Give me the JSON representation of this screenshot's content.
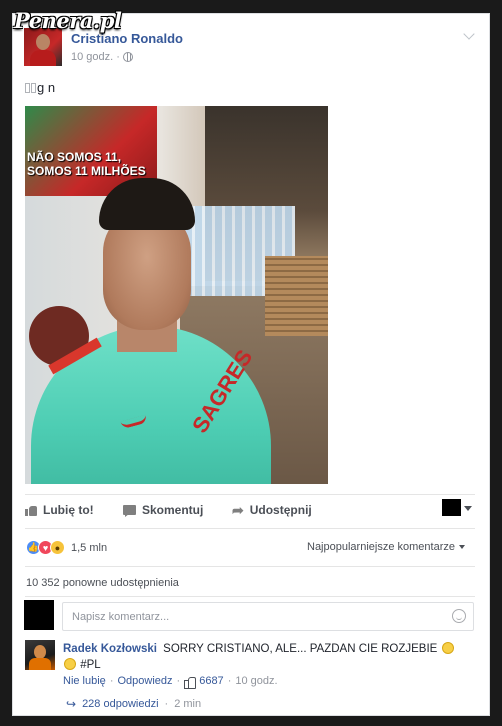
{
  "watermark": "Penera.pl",
  "post": {
    "author": "Cristiano Ronaldo",
    "time": "10 godz.",
    "separator": "·",
    "privacy_icon": "globe-icon",
    "text_visible": "g n",
    "photo": {
      "poster_text": "NÃO SOMOS 11,\nSOMOS 11 MILHÕES",
      "sponsor_text": "SAGRES"
    }
  },
  "actions": {
    "like": "Lubię to!",
    "comment": "Skomentuj",
    "share": "Udostępnij"
  },
  "reactions": {
    "icons": [
      "like-reaction",
      "love-reaction",
      "wow-reaction"
    ],
    "count": "1,5 mln"
  },
  "sort_label": "Najpopularniejsze komentarze",
  "shares_text": "10 352 ponowne udostępnienia",
  "comment_box": {
    "placeholder": "Napisz komentarz..."
  },
  "top_comment": {
    "author": "Radek Kozłowski",
    "text": "SORRY CRISTIANO, ALE... PAZDAN CIE ROZJEBIE",
    "tag": "#PL",
    "dislike": "Nie lubię",
    "reply": "Odpowiedz",
    "likes": "6687",
    "time": "10 godz.",
    "replies": "228 odpowiedzi",
    "replies_time": "2 min"
  },
  "colors": {
    "link": "#365899",
    "muted": "#90949c",
    "text": "#1d2129",
    "like_reaction": "#4d8df5",
    "love_reaction": "#f0475b",
    "wow_reaction": "#f6c33b"
  }
}
